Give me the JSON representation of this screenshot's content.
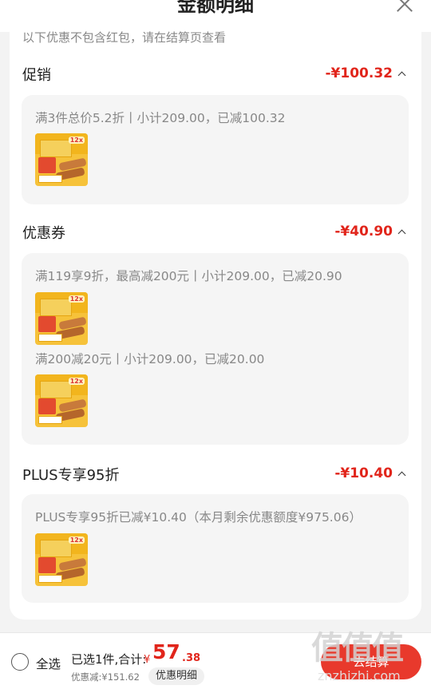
{
  "header": {
    "title": "金额明细"
  },
  "note": "以下优惠不包含红包，请在结算页查看",
  "sections": [
    {
      "title": "促销",
      "amount": "-¥100.32",
      "rules": [
        "满3件总价5.2折丨小计209.00，已减100.32"
      ]
    },
    {
      "title": "优惠券",
      "amount": "-¥40.90",
      "rules": [
        "满119享9折，最高减200元丨小计209.00，已减20.90",
        "满200减20元丨小计209.00，已减20.00"
      ]
    },
    {
      "title": "PLUS专享95折",
      "amount": "-¥10.40",
      "rules": [
        "PLUS专享95折已减¥10.40（本月剩余优惠额度¥975.06）"
      ]
    }
  ],
  "product": {
    "badge": "12x"
  },
  "footer": {
    "select_all": "全选",
    "selected": "已选1件,合计:",
    "currency": "¥",
    "total_int": "57",
    "total_dec": ".38",
    "discount": "优惠减:¥151.62",
    "detail_button": "优惠明细",
    "checkout_button": "去结算"
  },
  "watermark": {
    "logo": "值值值",
    "url": "znzhizhi.com"
  },
  "colors": {
    "accent": "#e1251b",
    "checkout": "#e8392c"
  }
}
